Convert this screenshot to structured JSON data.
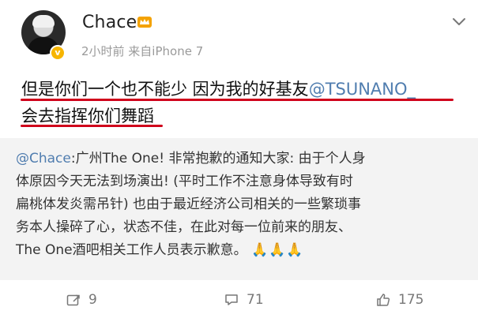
{
  "user": {
    "name": "Chace",
    "meta": "2小时前  来自iPhone 7"
  },
  "post": {
    "line1_plain": "但是你们一个也不能少 因为我的好基友",
    "line1_mention": "@TSUNANO_",
    "line2": "会去指挥你们舞蹈"
  },
  "repost": {
    "mention": "@Chace",
    "line1_rest": ":广州The One! 非常抱歉的通知大家: 由于个人身",
    "line2": "体原因今天无法到场演出! (平时工作不注意身体导致有时",
    "line3": "扁桃体发炎需吊针) 也由于最近经济公司相关的一些繁琐事",
    "line4": "务本人操碎了心，状态不佳，在此对每一位前来的朋友、",
    "line5": "The One酒吧相关工作人员表示歉意。",
    "emojis": "🙏🙏🙏"
  },
  "actions": {
    "repost_count": "9",
    "comment_count": "71",
    "like_count": "175"
  },
  "colors": {
    "mention": "#507daf",
    "underline": "#d0021b",
    "badge": "#f7b500"
  }
}
